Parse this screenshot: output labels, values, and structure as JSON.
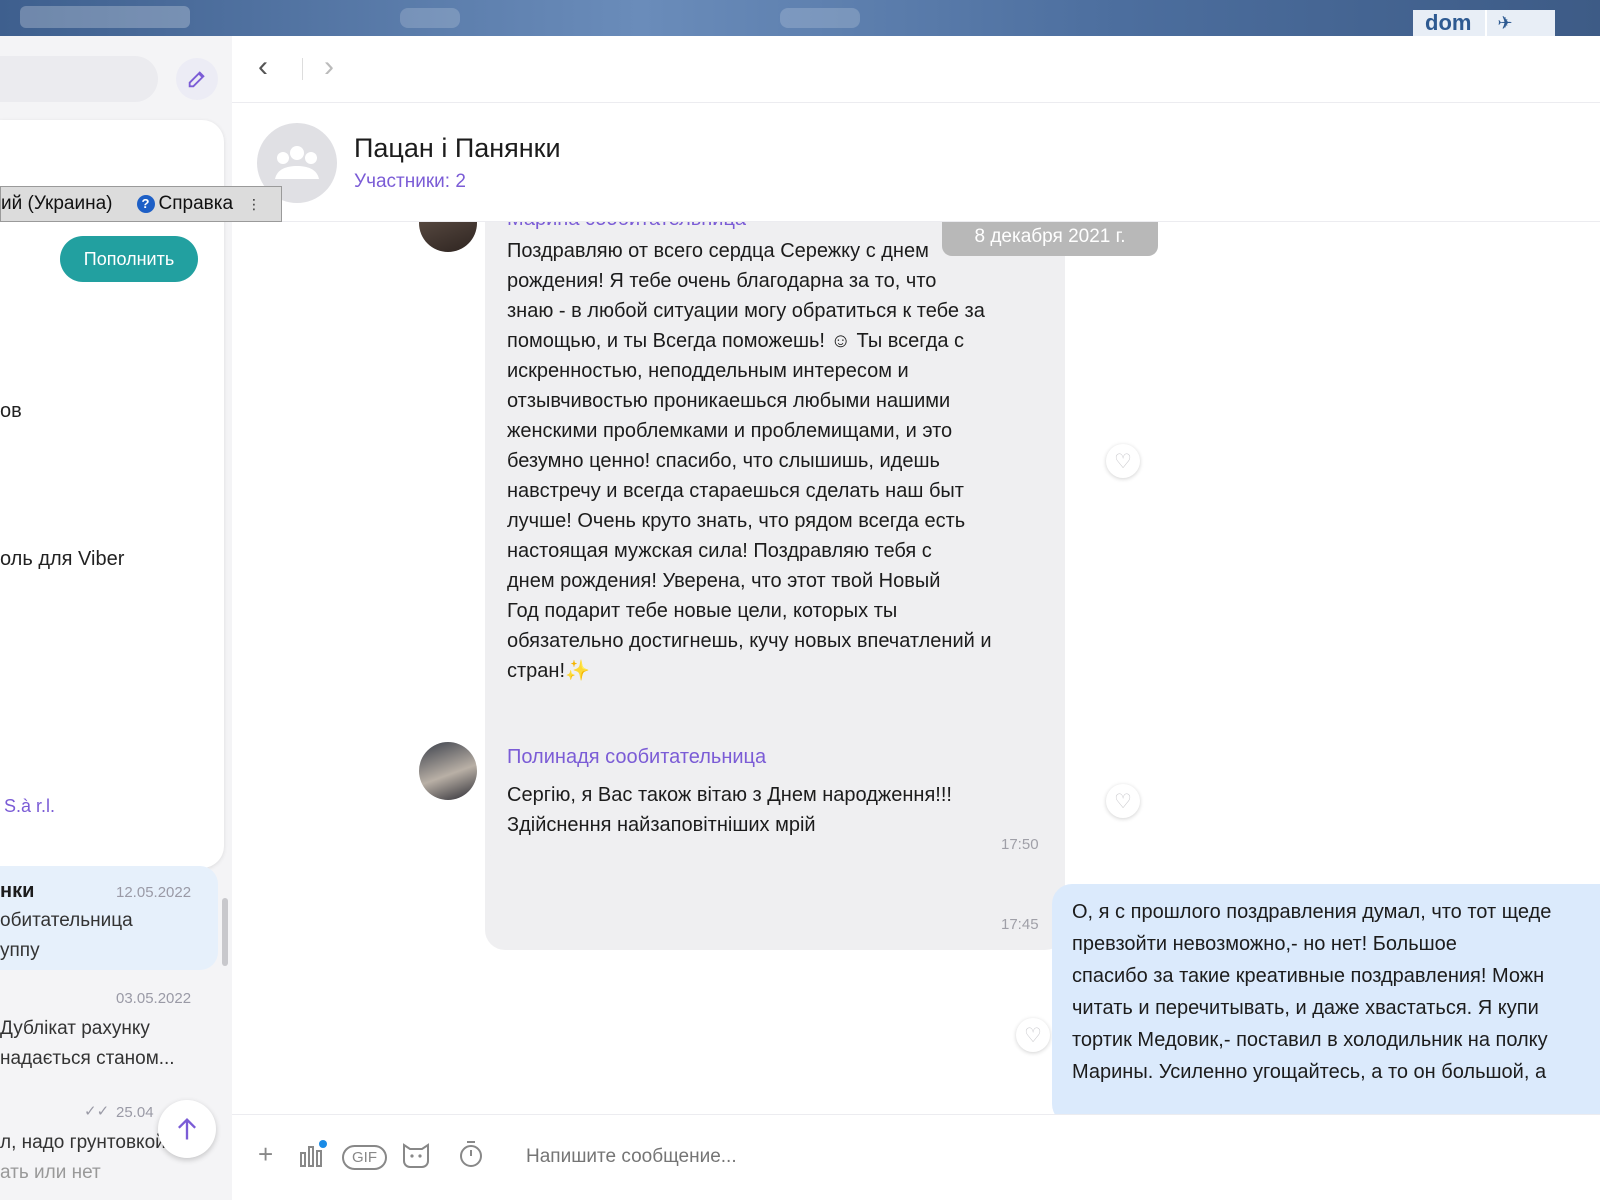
{
  "topbar": {
    "logo_text": "dom"
  },
  "sidebar": {
    "lang_text": "ий (Украина)",
    "help_label": "Справка",
    "topup_label": "Пополнить",
    "panel_items": [
      "ов",
      "оль для Viber",
      "S.à r.l."
    ],
    "chats": [
      {
        "title": "нки",
        "date": "12.05.2022",
        "line1": "обитательница",
        "line2": "уппу"
      },
      {
        "title": "",
        "date": "03.05.2022",
        "line1": "Дублікат рахунку",
        "line2": "надається станом..."
      },
      {
        "title": "",
        "date": "25.04",
        "line1": "л, надо грунтовкой",
        "line2": "ать или нет"
      }
    ]
  },
  "header": {
    "title": "Пацан і Панянки",
    "subtitle": "Участники: 2"
  },
  "messages": {
    "date_chip": "8 декабря 2021 г.",
    "m1": {
      "sender": "Марина сообитательница",
      "text": "Поздравляю от всего сердца Сережку с днем\nрождения!  Я тебе очень благодарна за то, что\nзнаю - в любой ситуации могу обратиться к тебе за\nпомощью, и ты Всегда поможешь! ☺ Ты всегда с\nискренностью, неподдельным интересом и\nотзывчивостью проникаешься любыми нашими\nженскими проблемками и проблемищами, и это\nбезумно ценно! спасибо, что слышишь, идешь\nнавстречу и всегда стараешься сделать наш быт\nлучше! Очень круто знать, что рядом всегда есть\nнастоящая мужская сила! Поздравляю тебя с\nднем рождения! Уверена, что этот твой Новый\nГод подарит тебе новые цели, которых ты\nобязательно достигнешь, кучу новых впечатлений и\nстран!✨",
      "time": "17:45"
    },
    "m2": {
      "sender": "Полинадя сообитательница",
      "text": "Сергію, я Вас також вітаю з Днем народження!!!\nЗдійснення найзаповітніших мрій",
      "time": "17:50"
    },
    "m3": {
      "text": "О, я с прошлого поздравления думал, что тот щеде\nпревзойти невозможно,- но нет! Большое\nспасибо за такие креативные поздравления! Можн\nчитать и перечитывать, и даже хвастаться. Я купи\nтортик Медовик,- поставил в холодильник на полку\nМарины. Усиленно угощайтесь, а то он большой, а"
    }
  },
  "composer": {
    "placeholder": "Напишите сообщение..."
  },
  "colors": {
    "accent": "#7b5cd6",
    "topup": "#22a0a0",
    "link": "#1a8be6",
    "mine_bubble": "#dbeafc"
  }
}
